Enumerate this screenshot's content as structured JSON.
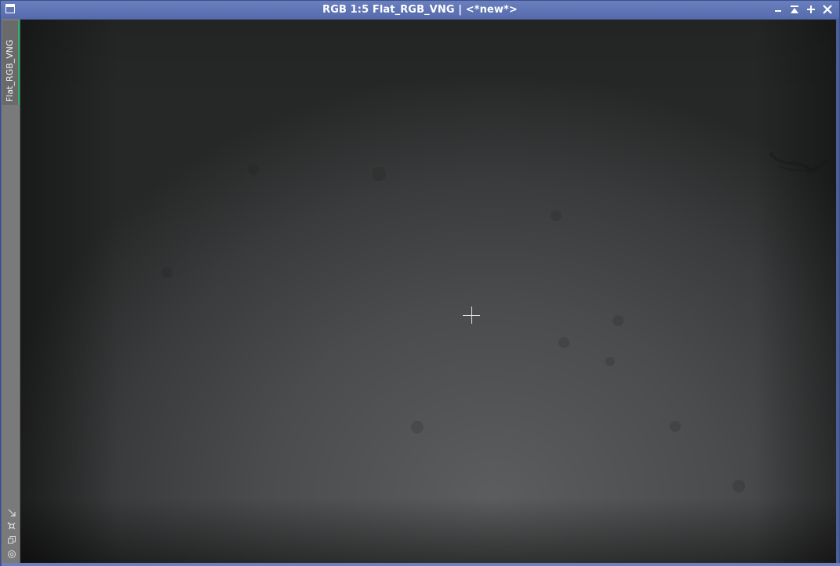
{
  "window": {
    "title": "RGB 1:5 Flat_RGB_VNG | <*new*>",
    "controls": [
      "minimize",
      "shade",
      "maximize",
      "close"
    ]
  },
  "sidebar": {
    "tab_label": "Flat_RGB_VNG",
    "tab_accent_color": "#2bb36a",
    "tools": [
      "arrow-icon",
      "fit-icon",
      "clone-icon",
      "circle-icon"
    ]
  },
  "image": {
    "description_colors": {
      "center": "#5c5d5e",
      "edge": "#262727"
    }
  }
}
